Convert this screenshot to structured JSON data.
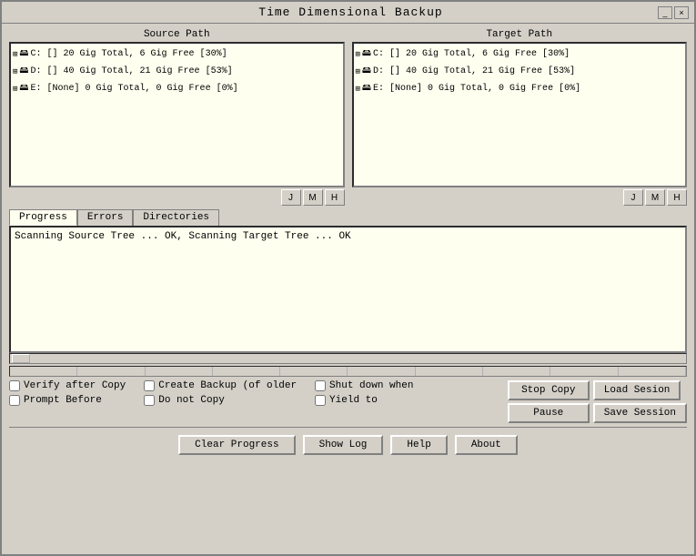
{
  "titleBar": {
    "title": "Time  Dimensional  Backup",
    "closeLabel": "×",
    "minimizeLabel": "_"
  },
  "sourcePanel": {
    "header": "Source Path",
    "items": [
      {
        "expand": "⊞",
        "icon": "💾",
        "label": "C: [] 20 Gig Total, 6 Gig Free [30%]"
      },
      {
        "expand": "⊞",
        "icon": "💾",
        "label": "D: [] 40 Gig Total, 21 Gig Free [53%]"
      },
      {
        "expand": "⊞",
        "icon": "💾",
        "label": "E: [None] 0 Gig Total, 0 Gig Free [0%]"
      }
    ],
    "buttons": [
      "J",
      "M",
      "H"
    ]
  },
  "targetPanel": {
    "header": "Target Path",
    "items": [
      {
        "expand": "⊞",
        "icon": "💾",
        "label": "C: [] 20 Gig Total, 6 Gig Free [30%]"
      },
      {
        "expand": "⊞",
        "icon": "💾",
        "label": "D: [] 40 Gig Total, 21 Gig Free [53%]"
      },
      {
        "expand": "⊞",
        "icon": "💾",
        "label": "E: [None] 0 Gig Total, 0 Gig Free [0%]"
      }
    ],
    "buttons": [
      "J",
      "M",
      "H"
    ]
  },
  "tabs": [
    {
      "label": "Progress",
      "active": true
    },
    {
      "label": "Errors",
      "active": false
    },
    {
      "label": "Directories",
      "active": false
    }
  ],
  "progressText": "Scanning Source Tree ... OK, Scanning  Target Tree ... OK",
  "checkboxes": {
    "verifyAfterCopy": {
      "label": "Verify after Copy",
      "checked": false
    },
    "promptBefore": {
      "label": "Prompt Before",
      "checked": false
    },
    "createBackup": {
      "label": "Create Backup (of older",
      "checked": false
    },
    "doNotCopy": {
      "label": "Do not Copy",
      "checked": false
    },
    "shutDownWhen": {
      "label": "Shut down when",
      "checked": false
    },
    "yieldTo": {
      "label": "Yield to",
      "checked": false
    }
  },
  "actionButtons": {
    "stopCopy": "Stop Copy",
    "loadSession": "Load Sesion",
    "pause": "Pause",
    "saveSession": "Save Session"
  },
  "bottomButtons": {
    "clearProgress": "Clear Progress",
    "showLog": "Show Log",
    "help": "Help",
    "about": "About"
  }
}
